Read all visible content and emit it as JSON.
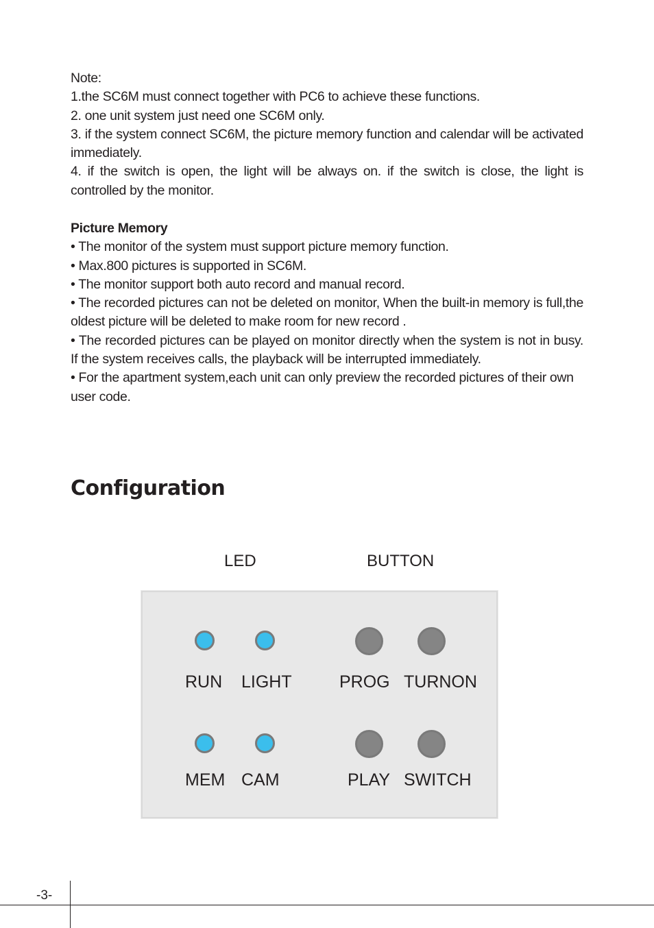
{
  "notes": {
    "label": "Note:",
    "items": [
      "1.the SC6M must connect together with PC6 to achieve these functions.",
      "2. one unit system just need one SC6M only.",
      "3. if the system connect SC6M, the picture memory function and calendar will be activated immediately.",
      "4. if the switch is open, the light will be always on. if the switch is close, the light is controlled by the monitor."
    ]
  },
  "picture_memory": {
    "heading": "Picture Memory",
    "bullets": [
      "• The monitor of the system must support picture memory function.",
      "• Max.800 pictures is supported in SC6M.",
      "• The monitor support both auto record and manual record.",
      "• The recorded pictures can not be deleted on monitor, When the built-in memory is full,the oldest picture will be deleted to make room for new record .",
      "• The recorded pictures can be played on monitor directly when the system is not in busy. If the system receives calls, the playback will be interrupted immediately.",
      "• For the apartment system,each unit can only preview the recorded pictures of their own user code."
    ]
  },
  "configuration": {
    "title": "Configuration",
    "led_header": "LED",
    "button_header": "BUTTON",
    "leds": [
      "RUN",
      "LIGHT",
      "MEM",
      "CAM"
    ],
    "buttons": [
      "PROG",
      "TURNON",
      "PLAY",
      "SWITCH"
    ],
    "colors": {
      "led": "#3bbeec",
      "button": "#858585",
      "panel": "#e8e8e8"
    }
  },
  "footer": {
    "page_number": "-3-"
  }
}
